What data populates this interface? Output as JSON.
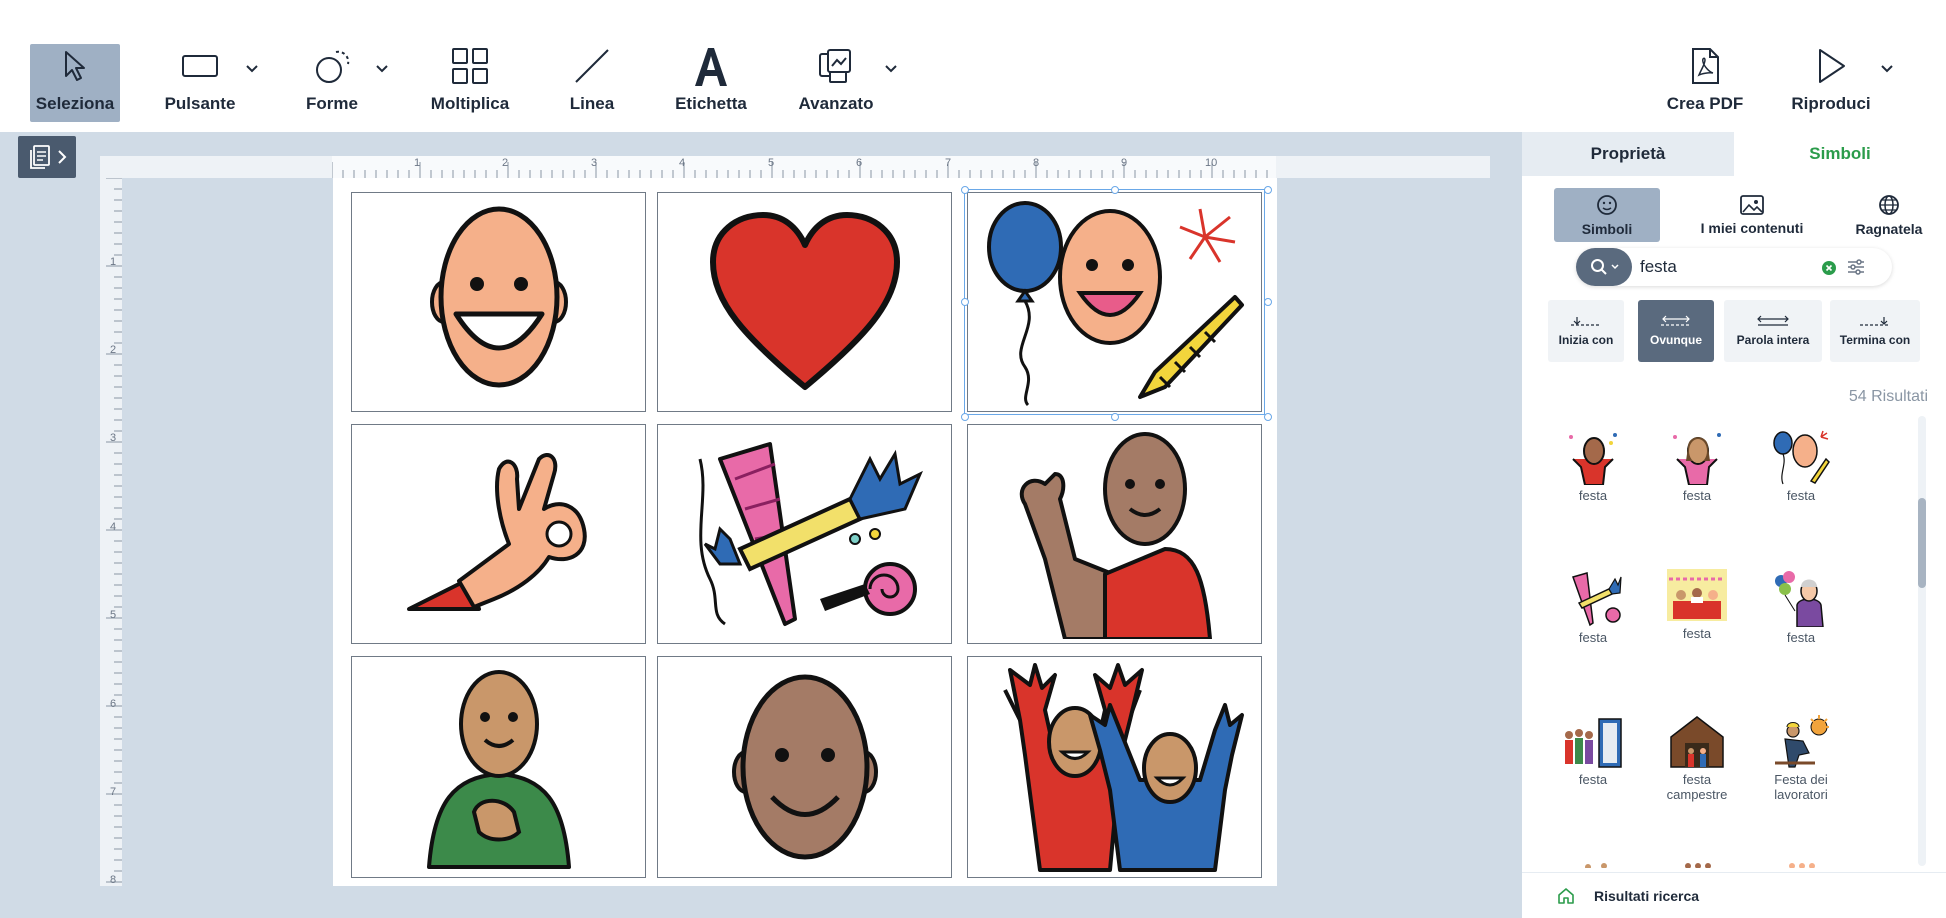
{
  "toolbar": {
    "tools": [
      {
        "label": "Seleziona",
        "icon": "cursor-icon"
      },
      {
        "label": "Pulsante",
        "icon": "rectangle-icon"
      },
      {
        "label": "Forme",
        "icon": "shapes-icon"
      },
      {
        "label": "Moltiplica",
        "icon": "grid-icon"
      },
      {
        "label": "Linea",
        "icon": "line-icon"
      },
      {
        "label": "Etichetta",
        "icon": "letter-a-icon"
      },
      {
        "label": "Avanzato",
        "icon": "advanced-icon"
      }
    ],
    "right_tools": [
      {
        "label": "Crea PDF",
        "icon": "pdf-icon"
      },
      {
        "label": "Riproduci",
        "icon": "play-icon"
      }
    ]
  },
  "ruler": {
    "h_numbers": [
      "1",
      "2",
      "3",
      "4",
      "5",
      "6",
      "7",
      "8",
      "9",
      "10"
    ],
    "v_numbers": [
      "1",
      "2",
      "3",
      "4",
      "5",
      "6",
      "7",
      "8"
    ]
  },
  "canvas": {
    "cells": [
      {
        "symbol": "smiling-face"
      },
      {
        "symbol": "heart"
      },
      {
        "symbol": "party-balloon"
      },
      {
        "symbol": "ok-hand"
      },
      {
        "symbol": "party-poppers"
      },
      {
        "symbol": "person-waving"
      },
      {
        "symbol": "person-hand-on-chest"
      },
      {
        "symbol": "brown-face"
      },
      {
        "symbol": "people-cheering"
      }
    ]
  },
  "panel": {
    "tabs": {
      "properties": "Proprietà",
      "symbols": "Simboli"
    },
    "sources": [
      {
        "label": "Simboli",
        "icon": "symbol-face-icon"
      },
      {
        "label": "I miei contenuti",
        "icon": "image-icon"
      },
      {
        "label": "Ragnatela",
        "icon": "globe-icon"
      }
    ],
    "search": {
      "value": "festa"
    },
    "match_modes": [
      {
        "label": "Inizia con"
      },
      {
        "label": "Ovunque"
      },
      {
        "label": "Parola intera"
      },
      {
        "label": "Termina con"
      }
    ],
    "results_count": "54 Risultati",
    "results": [
      {
        "label": "festa"
      },
      {
        "label": "festa"
      },
      {
        "label": "festa"
      },
      {
        "label": "festa"
      },
      {
        "label": "festa"
      },
      {
        "label": "festa"
      },
      {
        "label": "festa"
      },
      {
        "label": "festa campestre"
      },
      {
        "label": "Festa dei lavoratori"
      }
    ],
    "bottom": {
      "label": "Risultati ricerca"
    }
  },
  "colors": {
    "accent_green": "#2b9c4b",
    "selected_gray": "#9fb0c4",
    "dark_slate": "#5a6a7e"
  }
}
